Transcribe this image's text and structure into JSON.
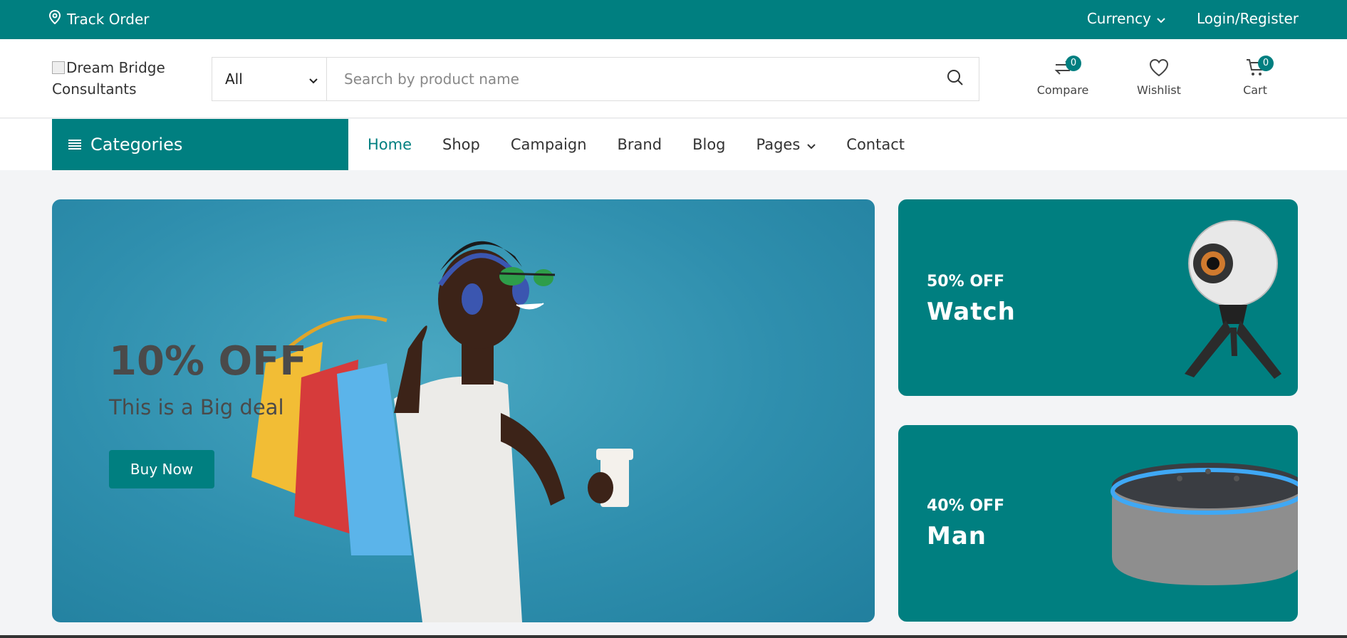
{
  "topbar": {
    "track_label": "Track Order",
    "currency_label": "Currency",
    "login_label": "Login/Register"
  },
  "header": {
    "logo_alt": "Dream Bridge Consultants",
    "search": {
      "category_value": "All",
      "placeholder": "Search by product name"
    },
    "compare": {
      "label": "Compare",
      "count": "0"
    },
    "wishlist": {
      "label": "Wishlist"
    },
    "cart": {
      "label": "Cart",
      "count": "0"
    }
  },
  "nav": {
    "categories_label": "Categories",
    "items": [
      {
        "label": "Home"
      },
      {
        "label": "Shop"
      },
      {
        "label": "Campaign"
      },
      {
        "label": "Brand"
      },
      {
        "label": "Blog"
      },
      {
        "label": "Pages"
      },
      {
        "label": "Contact"
      }
    ]
  },
  "hero": {
    "title": "10% OFF",
    "subtitle": "This is a Big deal",
    "button_label": "Buy Now"
  },
  "banners": [
    {
      "discount": "50% OFF",
      "name": "Watch"
    },
    {
      "discount": "40% OFF",
      "name": "Man"
    }
  ],
  "colors": {
    "accent": "#007f80",
    "hero_bg": "#3a9bb8",
    "page_bg": "#f3f4f6"
  }
}
